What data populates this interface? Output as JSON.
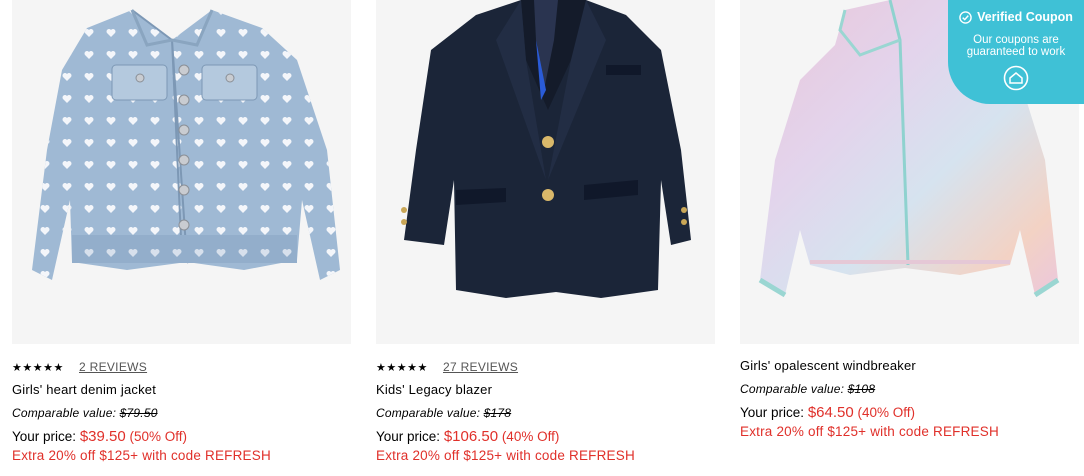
{
  "products": [
    {
      "stars": "★★★★★",
      "reviews": "2 REVIEWS",
      "name": "Girls' heart denim jacket",
      "comparable_label": "Comparable value:",
      "comparable_price": "$79.50",
      "price_label": "Your price:",
      "price": "$39.50",
      "discount": "(50% Off)",
      "promo": "Extra 20% off $125+ with code REFRESH"
    },
    {
      "stars": "★★★★★",
      "reviews": "27 REVIEWS",
      "name": "Kids' Legacy blazer",
      "comparable_label": "Comparable value:",
      "comparable_price": "$178",
      "price_label": "Your price:",
      "price": "$106.50",
      "discount": "(40% Off)",
      "promo": "Extra 20% off $125+ with code REFRESH"
    },
    {
      "name": "Girls' opalescent windbreaker",
      "comparable_label": "Comparable value:",
      "comparable_price": "$108",
      "price_label": "Your price:",
      "price": "$64.50",
      "discount": "(40% Off)",
      "promo": "Extra 20% off $125+ with code REFRESH"
    }
  ],
  "coupon": {
    "title": "Verified Coupon",
    "subtitle": "Our coupons are guaranteed to work",
    "icon": "check-circle-icon",
    "logo_icon": "house-badge-icon",
    "color": "#3fc1d6"
  },
  "colors": {
    "sale": "#e0302a",
    "image_bg": "#f5f5f5"
  }
}
